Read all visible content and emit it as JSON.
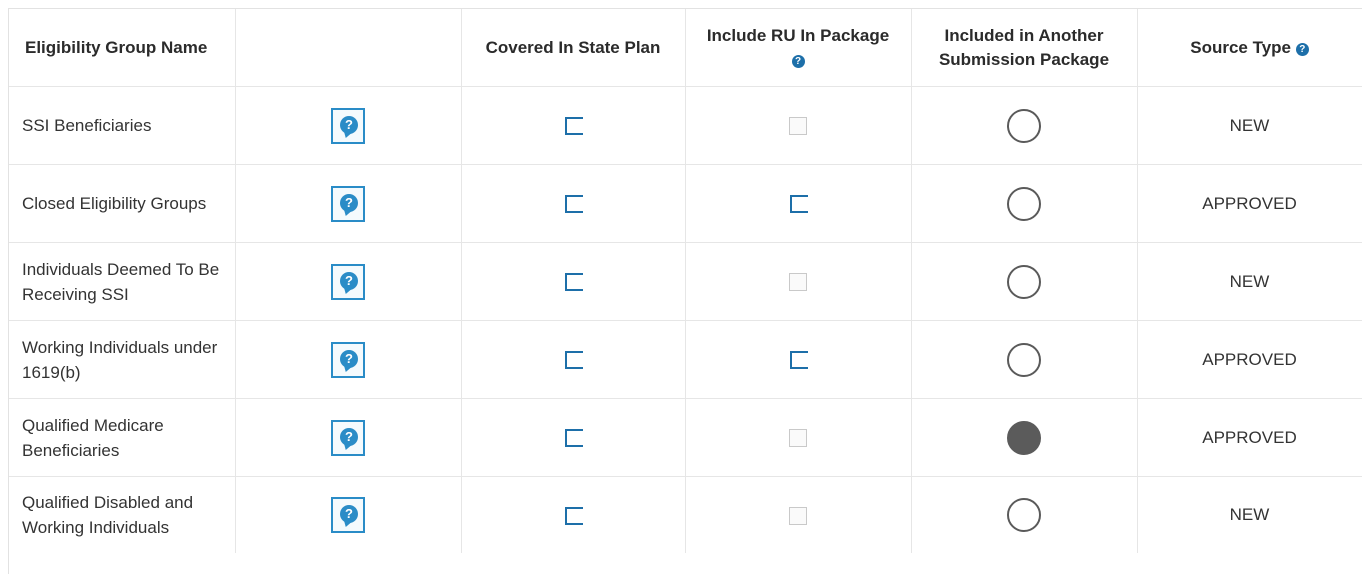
{
  "table": {
    "headers": {
      "eligibility_group_name": "Eligibility Group Name",
      "blank": "",
      "covered_in_state_plan": "Covered In State Plan",
      "include_ru_in_package": "Include RU In Package",
      "included_in_another_submission_package": "Included in Another Submission Package",
      "source_type": "Source Type"
    },
    "rows": [
      {
        "name": "SSI Beneficiaries",
        "include_ru": "checkbox",
        "included_in_another": false,
        "source_type": "NEW"
      },
      {
        "name": "Closed Eligibility Groups",
        "include_ru": "bracket",
        "included_in_another": false,
        "source_type": "APPROVED"
      },
      {
        "name": "Individuals Deemed To Be Receiving SSI",
        "include_ru": "checkbox",
        "included_in_another": false,
        "source_type": "NEW"
      },
      {
        "name": "Working Individuals under 1619(b)",
        "include_ru": "bracket",
        "included_in_another": false,
        "source_type": "APPROVED"
      },
      {
        "name": "Qualified Medicare Beneficiaries",
        "include_ru": "checkbox",
        "included_in_another": true,
        "source_type": "APPROVED"
      },
      {
        "name": "Qualified Disabled and Working Individuals",
        "include_ru": "checkbox",
        "included_in_another": false,
        "source_type": "NEW"
      }
    ]
  },
  "icons": {
    "help_icon": "question-circle-icon",
    "tooltip_icon": "question-speech-bubble-icon"
  },
  "colors": {
    "accent_blue": "#1d6fa9",
    "tooltip_blue": "#2a8cc7",
    "radio_gray": "#5b5b5b",
    "border": "#e6e6e6"
  }
}
